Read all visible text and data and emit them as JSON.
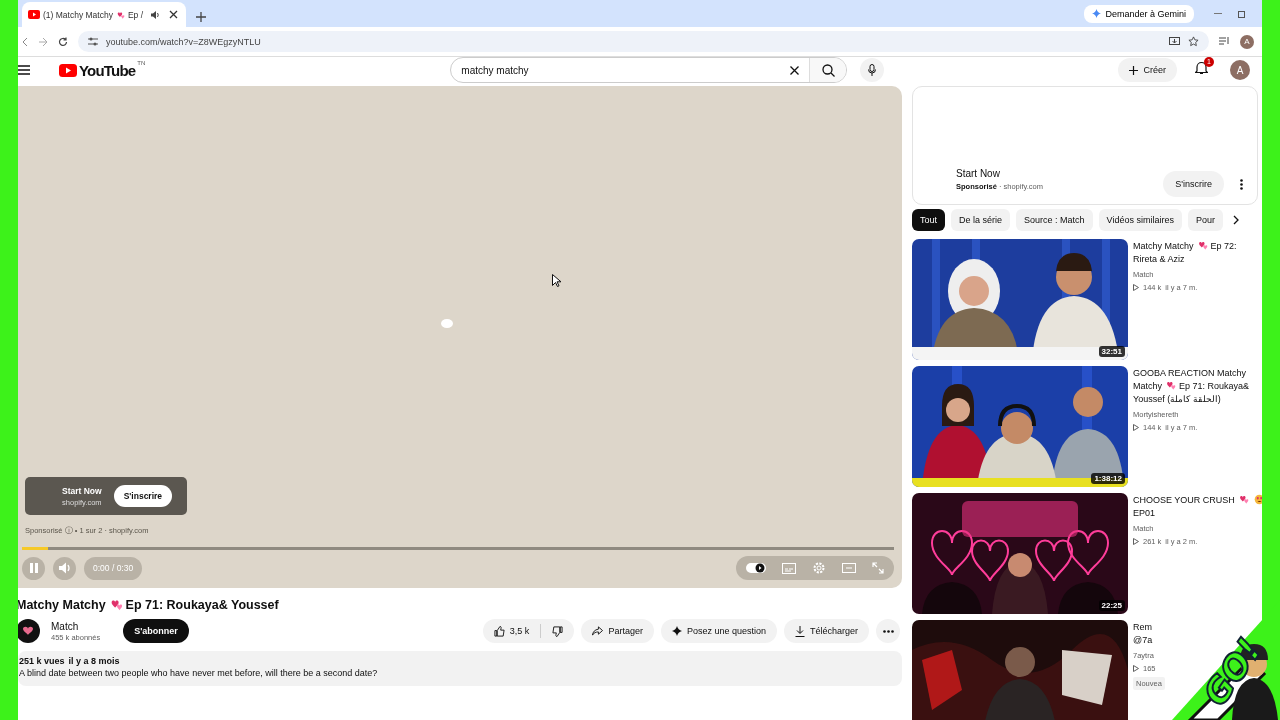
{
  "browser": {
    "tab_title": [
      {
        "kind": "text",
        "text": "(1) Matchy Matchy"
      },
      {
        "kind": "heart"
      },
      {
        "kind": "text",
        "text": "Ep /"
      }
    ],
    "gemini_button": "Demander à Gemini",
    "url": "youtube.com/watch?v=Z8WEgzyNTLU",
    "profile_initial": "A"
  },
  "header": {
    "logo_text": "YouTube",
    "logo_country": "TN",
    "search_value": "matchy matchy",
    "create_label": "Créer",
    "notification_count": "1",
    "avatar_initial": "A"
  },
  "player": {
    "playing": true,
    "level": 0.03,
    "time": "0:00 / 0:30",
    "ad": {
      "title": "Start Now",
      "domain": "shopify.com",
      "button": "S'inscrire"
    },
    "ad_info": "Sponsorisé ⓘ • 1 sur 2 · shopify.com"
  },
  "video": {
    "title": [
      {
        "kind": "text",
        "text": "Matchy Matchy"
      },
      {
        "kind": "heart"
      },
      {
        "kind": "text",
        "text": "Ep 71: Roukaya& Youssef"
      }
    ],
    "channel": "Match",
    "subscribers": "455 k abonnés",
    "subscribe": "S'abonner",
    "likes": "3,5 k",
    "share": "Partager",
    "ask": "Posez une question",
    "download": "Télécharger",
    "views": "251 k vues",
    "age": "il y a 8 mois",
    "description": "A blind date between two people who have never met before, will there be a second date?"
  },
  "sidebar": {
    "ad": {
      "title": "Start Now",
      "sponsor": "Sponsorisé",
      "separator": "·",
      "domain": "shopify.com",
      "button": "S'inscrire"
    },
    "chips": [
      {
        "label": "Tout",
        "selected": true
      },
      {
        "label": "De la série",
        "selected": false
      },
      {
        "label": "Source : Match",
        "selected": false
      },
      {
        "label": "Vidéos similaires",
        "selected": false
      },
      {
        "label": "Pour",
        "selected": false
      }
    ],
    "videos": [
      {
        "duration": "32:51",
        "title": [
          {
            "kind": "text",
            "text": "Matchy Matchy"
          },
          {
            "kind": "heart"
          },
          {
            "kind": "text",
            "text": "Ep 72:"
          },
          {
            "kind": "break"
          },
          {
            "kind": "text",
            "text": "Rireta & Aziz"
          }
        ],
        "channel": "Match",
        "views": "144 k",
        "age": "il y a 7 m."
      },
      {
        "duration": "1:38:12",
        "title": [
          {
            "kind": "text",
            "text": "GOOBA REACTION Matchy"
          },
          {
            "kind": "break"
          },
          {
            "kind": "text",
            "text": "Matchy"
          },
          {
            "kind": "heart"
          },
          {
            "kind": "text",
            "text": "Ep 71: Roukaya&"
          },
          {
            "kind": "break"
          },
          {
            "kind": "text",
            "text": "Youssef (الحلقة كاملة)"
          }
        ],
        "channel": "Mortyishereth",
        "views": "144 k",
        "age": "il y a 7 m."
      },
      {
        "duration": "22:25",
        "title": [
          {
            "kind": "text",
            "text": "CHOOSE YOUR CRUSH"
          },
          {
            "kind": "heart"
          },
          {
            "kind": "smiley"
          },
          {
            "kind": "break"
          },
          {
            "kind": "text",
            "text": "EP01"
          }
        ],
        "channel": "Match",
        "views": "261 k",
        "age": "il y a 2 m."
      },
      {
        "title": [
          {
            "kind": "text",
            "text": "Rem"
          },
          {
            "kind": "break"
          },
          {
            "kind": "text",
            "text": "@7a"
          }
        ],
        "channel": "7aytra",
        "views": "165",
        "badge": "Nouvea"
      }
    ]
  },
  "overlay": {
    "text": "GO!"
  }
}
